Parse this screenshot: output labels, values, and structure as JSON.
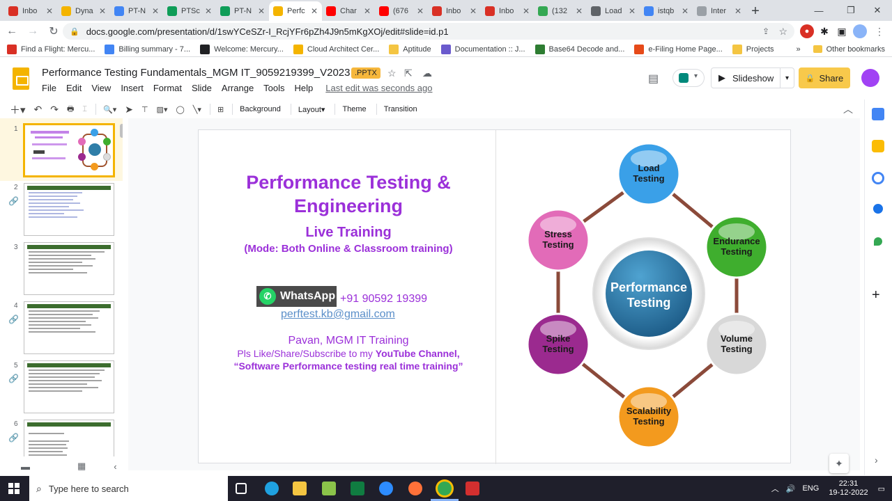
{
  "browser": {
    "tabs": [
      {
        "label": "Inbo",
        "color": "#d93025",
        "active": false
      },
      {
        "label": "Dyna",
        "color": "#f4b400",
        "active": false
      },
      {
        "label": "PT-N",
        "color": "#4285f4",
        "active": false
      },
      {
        "label": "PTSc",
        "color": "#0f9d58",
        "active": false
      },
      {
        "label": "PT-N",
        "color": "#0f9d58",
        "active": false
      },
      {
        "label": "Perfc",
        "color": "#f4b400",
        "active": true
      },
      {
        "label": "Char",
        "color": "#ff0000",
        "active": false
      },
      {
        "label": "(676",
        "color": "#ff0000",
        "active": false
      },
      {
        "label": "Inbo",
        "color": "#d93025",
        "active": false
      },
      {
        "label": "Inbo",
        "color": "#d93025",
        "active": false
      },
      {
        "label": "(132",
        "color": "#34a853",
        "active": false
      },
      {
        "label": "Load",
        "color": "#5f6368",
        "active": false
      },
      {
        "label": "istqb",
        "color": "#4285f4",
        "active": false
      },
      {
        "label": "Inter",
        "color": "#9aa0a6",
        "active": false
      }
    ],
    "new_tab": "+",
    "url": "docs.google.com/presentation/d/1swYCeSZr-I_RcjYFr6pZh4J9n5mKgXOj/edit#slide=id.p1",
    "bookmarks": [
      {
        "label": "Find a Flight: Mercu...",
        "color": "#d93025"
      },
      {
        "label": "Billing summary - 7...",
        "color": "#4285f4"
      },
      {
        "label": "Welcome: Mercury...",
        "color": "#202124"
      },
      {
        "label": "Cloud Architect Cer...",
        "color": "#f4b400"
      },
      {
        "label": "Aptitude",
        "color": "#f4c542"
      },
      {
        "label": "Documentation :: J...",
        "color": "#6a5acd"
      },
      {
        "label": "Base64 Decode and...",
        "color": "#2e7d32"
      },
      {
        "label": "e-Filing Home Page...",
        "color": "#e64a19"
      },
      {
        "label": "Projects",
        "color": "#f4c542"
      }
    ],
    "more_bookmarks": "»",
    "other_bookmarks": "Other bookmarks"
  },
  "docs": {
    "title": "Performance Testing Fundamentals_MGM IT_9059219399_V2023",
    "badge": ".PPTX",
    "menu": [
      "File",
      "Edit",
      "View",
      "Insert",
      "Format",
      "Slide",
      "Arrange",
      "Tools",
      "Help"
    ],
    "last_edit": "Last edit was seconds ago",
    "slideshow": "Slideshow",
    "share": "Share"
  },
  "toolbar": {
    "background": "Background",
    "layout": "Layout",
    "theme": "Theme",
    "transition": "Transition"
  },
  "thumbnails": [
    "1",
    "2",
    "3",
    "4",
    "5",
    "6"
  ],
  "slide": {
    "title_line1": "Performance Testing &",
    "title_line2": "Engineering",
    "subtitle": "Live Training",
    "mode": "(Mode: Both Online & Classroom training)",
    "whatsapp": "WhatsApp",
    "phone": "+91 90592 19399",
    "email": "perftest.kb@gmail.com",
    "trainer": "Pavan, MGM IT Training",
    "youtube_prefix": "Pls Like/Share/Subscribe to my ",
    "youtube_bold": "YouTube Channel,",
    "channel_name": "“Software Performance testing real time training”",
    "diagram": {
      "center": "Performance Testing",
      "nodes": [
        {
          "label": "Load Testing",
          "color": "#3aa0e8"
        },
        {
          "label": "Endurance Testing",
          "color": "#3fae2e"
        },
        {
          "label": "Volume Testing",
          "color": "#d8d8d8"
        },
        {
          "label": "Scalability Testing",
          "color": "#f39a1e"
        },
        {
          "label": "Spike Testing",
          "color": "#9b2a8f"
        },
        {
          "label": "Stress Testing",
          "color": "#e26bb8"
        }
      ]
    }
  },
  "taskbar": {
    "search_placeholder": "Type here to search",
    "language": "ENG",
    "time": "22:31",
    "date": "19-12-2022"
  }
}
